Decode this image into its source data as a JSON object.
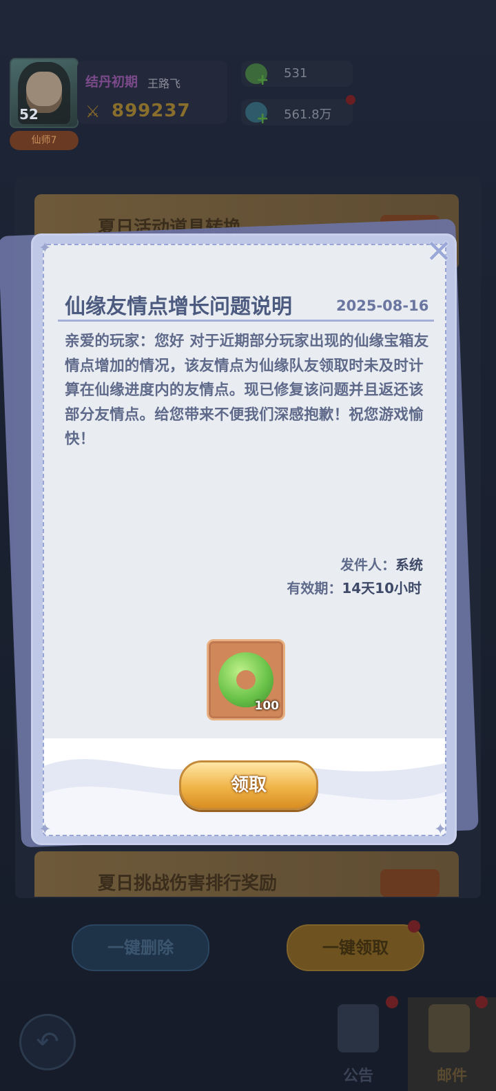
{
  "player": {
    "level": "52",
    "realm": "结丹初期",
    "name": "王路飞",
    "title_badge": "仙师7",
    "power": "899237"
  },
  "resources": [
    {
      "icon": "gem-icon",
      "value": "531"
    },
    {
      "icon": "spirit-stone-icon",
      "value": "561.8万"
    }
  ],
  "mail_list": [
    {
      "title": "夏日活动道具转换"
    },
    {
      "title": "夏日挑战伤害排行奖励"
    }
  ],
  "bottom_buttons": {
    "delete_all": "一键删除",
    "claim_all": "一键领取"
  },
  "nav": {
    "notice": "公告",
    "mail": "邮件"
  },
  "modal": {
    "title": "仙缘友情点增长问题说明",
    "date": "2025-08-16",
    "body": "亲爱的玩家：您好 对于近期部分玩家出现的仙缘宝箱友情点增加的情况，该友情点为仙缘队友领取时未及时计算在仙缘进度内的友情点。现已修复该问题并且返还该部分友情点。给您带来不便我们深感抱歉！祝您游戏愉快！",
    "sender_label": "发件人：",
    "sender_value": "系统",
    "expire_label": "有效期：",
    "expire_value": "14天10小时",
    "attachment": {
      "icon": "jade-ring-icon",
      "quantity": "100"
    },
    "claim_button": "领取"
  },
  "colors": {
    "modal_bg": "#e9edf2",
    "title_text": "#4b5a7e",
    "claim_button": "#f0b448"
  }
}
